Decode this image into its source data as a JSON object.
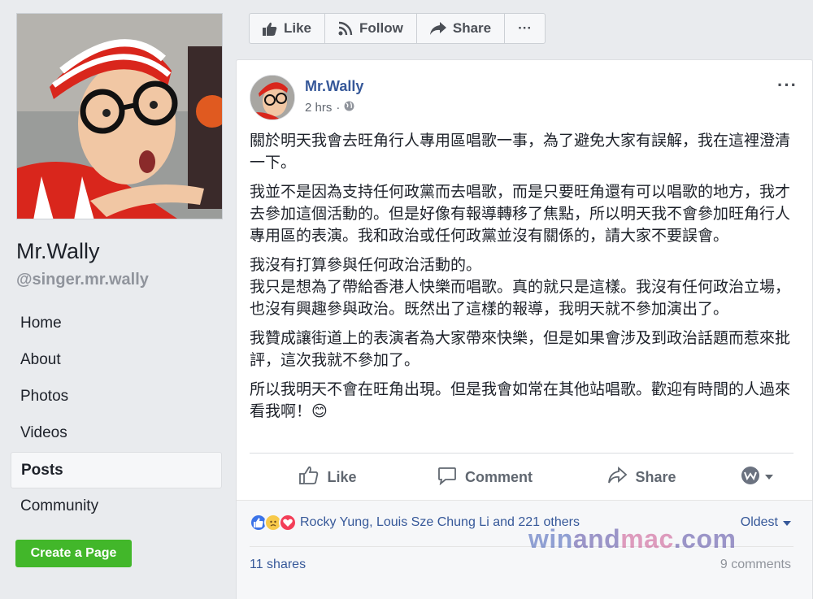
{
  "page": {
    "name": "Mr.Wally",
    "handle": "@singer.mr.wally"
  },
  "nav": [
    {
      "label": "Home",
      "active": false
    },
    {
      "label": "About",
      "active": false
    },
    {
      "label": "Photos",
      "active": false
    },
    {
      "label": "Videos",
      "active": false
    },
    {
      "label": "Posts",
      "active": true
    },
    {
      "label": "Community",
      "active": false
    }
  ],
  "create_page_label": "Create a Page",
  "actionbar": {
    "like": "Like",
    "follow": "Follow",
    "share": "Share",
    "more": "···"
  },
  "post": {
    "author": "Mr.Wally",
    "time": "2 hrs",
    "more": "···",
    "paragraphs": [
      "關於明天我會去旺角行人專用區唱歌一事，為了避免大家有誤解，我在這裡澄清一下。",
      "我並不是因為支持任何政黨而去唱歌，而是只要旺角還有可以唱歌的地方，我才去參加這個活動的。但是好像有報導轉移了焦點，所以明天我不會參加旺角行人專用區的表演。我和政治或任何政黨並沒有關係的，請大家不要誤會。",
      "我沒有打算參與任何政治活動的。\n我只是想為了帶給香港人快樂而唱歌。真的就只是這樣。我沒有任何政治立場，也沒有興趣參與政治。既然出了這樣的報導，我明天就不參加演出了。",
      "我贊成讓街道上的表演者為大家帶來快樂，但是如果會涉及到政治話題而惹來批評，這次我就不參加了。",
      "所以我明天不會在旺角出現。但是我會如常在其他站唱歌。歡迎有時間的人過來看我啊！😊"
    ],
    "actions": {
      "like": "Like",
      "comment": "Comment",
      "share": "Share"
    },
    "reactions_text": "Rocky Yung, Louis Sze Chung Li and 221 others",
    "sort_label": "Oldest",
    "shares": "11 shares",
    "comments": "9 comments"
  },
  "watermark": {
    "part1": "win",
    "part2": "and",
    "part3": "mac",
    "part4": ".com"
  },
  "colors": {
    "link": "#365899",
    "green": "#42b72a",
    "background": "#e9ebee"
  }
}
